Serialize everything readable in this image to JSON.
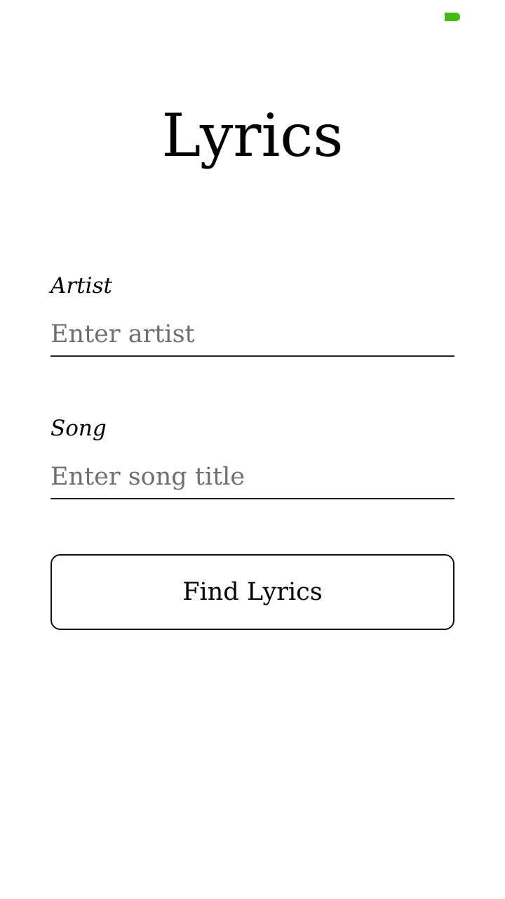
{
  "status_bar": {
    "indicator_color": "#44bb11",
    "indicator_icon": "battery-icon"
  },
  "title": "Lyrics",
  "artist": {
    "label": "Artist",
    "value": "",
    "placeholder": "Enter artist"
  },
  "song": {
    "label": "Song",
    "value": "",
    "placeholder": "Enter song title"
  },
  "find_button_label": "Find Lyrics"
}
